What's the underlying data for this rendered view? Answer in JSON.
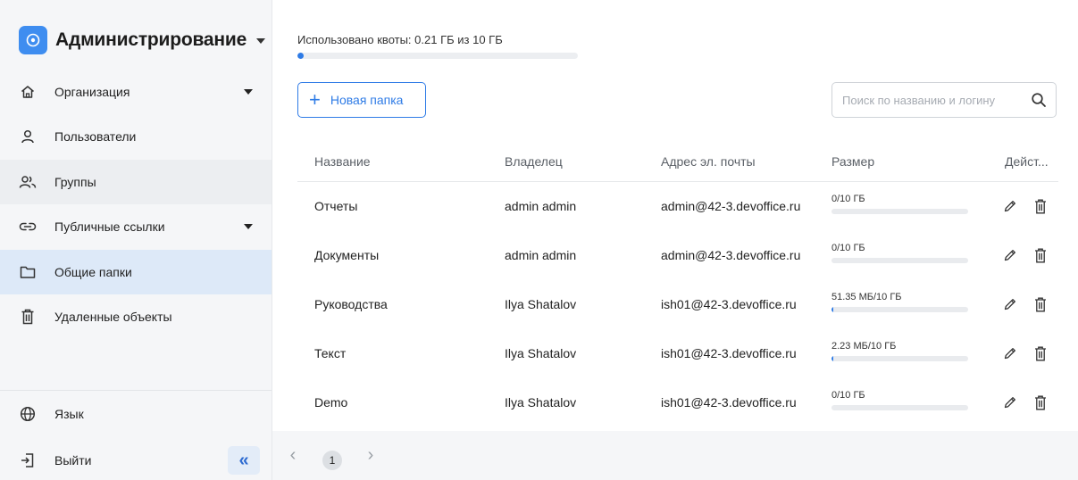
{
  "sidebar": {
    "title": "Администрирование",
    "items": [
      {
        "label": "Организация"
      },
      {
        "label": "Пользователи"
      },
      {
        "label": "Группы"
      },
      {
        "label": "Публичные ссылки"
      },
      {
        "label": "Общие папки"
      },
      {
        "label": "Удаленные объекты"
      }
    ],
    "bottom": [
      {
        "label": "Язык"
      },
      {
        "label": "Выйти"
      }
    ],
    "collapse_label": "«"
  },
  "quota": {
    "text": "Использовано квоты: 0.21 ГБ из 10 ГБ",
    "fraction": 0.021
  },
  "toolbar": {
    "new_folder_label": "Новая папка",
    "search_placeholder": "Поиск по названию и логину"
  },
  "table": {
    "headers": [
      "Название",
      "Владелец",
      "Адрес эл. почты",
      "Размер",
      "Дейст..."
    ],
    "rows": [
      {
        "name": "Отчеты",
        "owner": "admin admin",
        "email": "admin@42-3.devoffice.ru",
        "size": "0/10 ГБ",
        "fill": 0
      },
      {
        "name": "Документы",
        "owner": "admin admin",
        "email": "admin@42-3.devoffice.ru",
        "size": "0/10 ГБ",
        "fill": 0
      },
      {
        "name": "Руководства",
        "owner": "Ilya Shatalov",
        "email": "ish01@42-3.devoffice.ru",
        "size": "51.35 МБ/10 ГБ",
        "fill": 0.005
      },
      {
        "name": "Текст",
        "owner": "Ilya Shatalov",
        "email": "ish01@42-3.devoffice.ru",
        "size": "2.23 МБ/10 ГБ",
        "fill": 0.0002
      },
      {
        "name": "Demo",
        "owner": "Ilya Shatalov",
        "email": "ish01@42-3.devoffice.ru",
        "size": "0/10 ГБ",
        "fill": 0
      }
    ]
  },
  "pagination": {
    "prev": "‹",
    "current": "1",
    "next": "›"
  },
  "colors": {
    "accent": "#2e7be6",
    "active_bg": "#dde9f8"
  }
}
